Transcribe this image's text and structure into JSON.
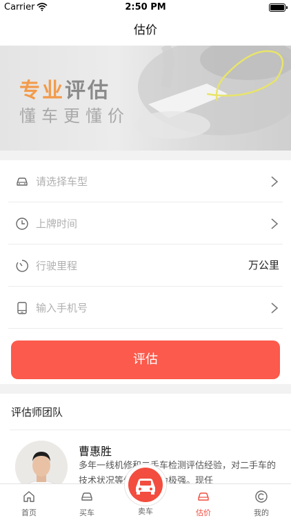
{
  "status_bar": {
    "carrier": "Carrier",
    "time": "2:50 PM"
  },
  "nav": {
    "title": "估价"
  },
  "banner": {
    "title_highlight": "专业",
    "title_rest": "评估",
    "subtitle": "懂车更懂价"
  },
  "form": {
    "car_model_placeholder": "请选择车型",
    "reg_time_placeholder": "上牌时间",
    "mileage_placeholder": "行驶里程",
    "mileage_unit": "万公里",
    "phone_placeholder": "输入手机号",
    "submit_label": "评估"
  },
  "team": {
    "title": "评估师团队",
    "appraiser": {
      "name": "曹惠胜",
      "description": "多年一线机修和二手车检测评估经验，对二手车的技术状况等信息鉴定力极强。现任"
    }
  },
  "tabbar": {
    "items": [
      {
        "label": "首页",
        "icon": "home-icon"
      },
      {
        "label": "买车",
        "icon": "car-icon"
      },
      {
        "label": "卖车",
        "icon": "car-icon"
      },
      {
        "label": "估价",
        "icon": "car-icon",
        "active": true
      },
      {
        "label": "我的",
        "icon": "profile-icon"
      }
    ]
  },
  "colors": {
    "accent": "#fb5a4c",
    "banner_orange": "#f29b4c",
    "tab_active": "#f04a3c"
  }
}
